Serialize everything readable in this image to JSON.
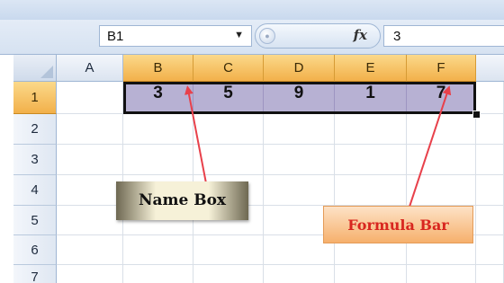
{
  "name_box": {
    "value": "B1"
  },
  "formula_bar": {
    "fx_label": "fx",
    "value": "3"
  },
  "column_headers": [
    "A",
    "B",
    "C",
    "D",
    "E",
    "F"
  ],
  "row_headers": [
    "1",
    "2",
    "3",
    "4",
    "5",
    "6",
    "7"
  ],
  "selection": {
    "row": "1",
    "columns": [
      "B",
      "C",
      "D",
      "E",
      "F"
    ]
  },
  "cells": {
    "B1": "3",
    "C1": "5",
    "D1": "9",
    "E1": "1",
    "F1": "7"
  },
  "callouts": {
    "name_box_label": "Name Box",
    "formula_bar_label": "Formula Bar"
  },
  "colors": {
    "selected_header": "#f2b04a",
    "selected_range": "#b7b1d3",
    "annotation_arrow": "#e8414b",
    "formula_callout_text": "#d8261f"
  }
}
